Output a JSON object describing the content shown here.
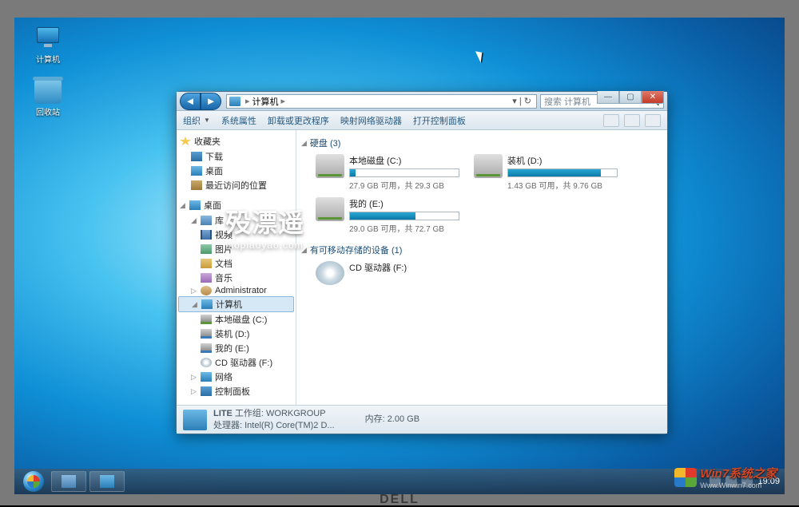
{
  "desktop": {
    "icons": [
      {
        "label": "计算机",
        "name": "desktop-icon-computer"
      },
      {
        "label": "回收站",
        "name": "desktop-icon-recycle-bin"
      }
    ]
  },
  "window": {
    "breadcrumb_root": "计算机",
    "search_placeholder": "搜索 计算机",
    "controls": {
      "min": "—",
      "max": "▢",
      "close": "✕"
    },
    "toolbar": {
      "organize": "组织",
      "sys_props": "系统属性",
      "uninstall": "卸载或更改程序",
      "map_drive": "映射网络驱动器",
      "open_cp": "打开控制面板"
    },
    "tree": {
      "favorites": "收藏夹",
      "downloads": "下载",
      "desktop": "桌面",
      "recent": "最近访问的位置",
      "desktop2": "桌面",
      "libraries": "库",
      "videos": "视频",
      "pictures": "图片",
      "documents": "文档",
      "music": "音乐",
      "admin": "Administrator",
      "computer": "计算机",
      "hdd_c": "本地磁盘 (C:)",
      "hdd_d": "装机 (D:)",
      "hdd_e": "我的 (E:)",
      "cd_f": "CD 驱动器 (F:)",
      "network": "网络",
      "control": "控制面板"
    },
    "sections": {
      "hdd": "硬盘 (3)",
      "removable": "有可移动存储的设备 (1)"
    },
    "drives": {
      "c": {
        "name": "本地磁盘 (C:)",
        "stat": "27.9 GB 可用，共 29.3 GB",
        "fill": 5
      },
      "d": {
        "name": "装机 (D:)",
        "stat": "1.43 GB 可用，共 9.76 GB",
        "fill": 85
      },
      "e": {
        "name": "我的 (E:)",
        "stat": "29.0 GB 可用，共 72.7 GB",
        "fill": 60
      },
      "f": {
        "name": "CD 驱动器 (F:)"
      }
    },
    "details": {
      "name": "LITE",
      "workgroup_label": "工作组:",
      "workgroup": "WORKGROUP",
      "cpu_label": "处理器:",
      "cpu": "Intel(R) Core(TM)2 D...",
      "mem_label": "内存:",
      "mem": "2.00 GB"
    }
  },
  "taskbar": {
    "clock": "19:09"
  },
  "watermark": {
    "main": "殁漂遥",
    "sub": "mopiaoyao.com",
    "corner": "Win7系统之家",
    "corner_sub": "Www.Winwin7.com"
  },
  "brand": "DELL"
}
